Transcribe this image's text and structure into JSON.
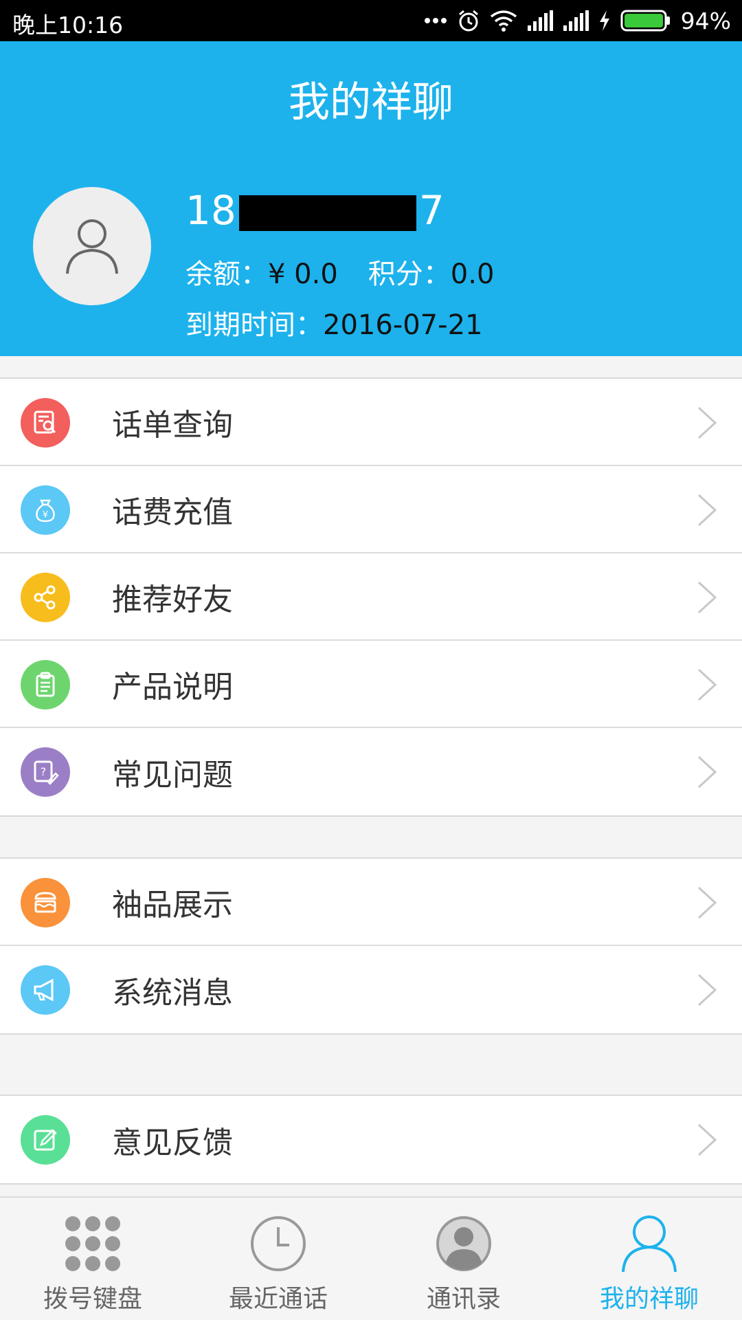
{
  "status_bar": {
    "time": "晚上10:16",
    "battery": "94%",
    "icons": [
      "more-dots-icon",
      "alarm-icon",
      "wifi-icon",
      "signal-icon",
      "signal-icon",
      "charging-icon",
      "battery-icon"
    ]
  },
  "header": {
    "title": "我的祥聊",
    "phone_prefix": "18",
    "phone_suffix": "7",
    "balance_label": "余额：",
    "balance_value": "¥ 0.0",
    "points_label": "积分：",
    "points_value": "0.0",
    "expire_label": "到期时间：",
    "expire_value": "2016-07-21"
  },
  "menu": {
    "group1": [
      {
        "label": "话单查询",
        "icon": "bill-search-icon",
        "color": "#f25f5c"
      },
      {
        "label": "话费充值",
        "icon": "money-bag-icon",
        "color": "#5bc8f5"
      },
      {
        "label": "推荐好友",
        "icon": "share-icon",
        "color": "#f7bd1c"
      },
      {
        "label": "产品说明",
        "icon": "clipboard-icon",
        "color": "#6ed56e"
      },
      {
        "label": "常见问题",
        "icon": "question-edit-icon",
        "color": "#9b7fc6"
      }
    ],
    "group2": [
      {
        "label": "袖品展示",
        "icon": "store-icon",
        "color": "#f9923a"
      },
      {
        "label": "系统消息",
        "icon": "megaphone-icon",
        "color": "#5bc8f5"
      }
    ],
    "group3": [
      {
        "label": "意见反馈",
        "icon": "feedback-edit-icon",
        "color": "#59e096"
      }
    ]
  },
  "bottom_nav": {
    "tabs": [
      {
        "label": "拨号键盘",
        "icon": "dialpad-icon"
      },
      {
        "label": "最近通话",
        "icon": "clock-icon"
      },
      {
        "label": "通讯录",
        "icon": "contact-icon"
      },
      {
        "label": "我的祥聊",
        "icon": "person-icon"
      }
    ],
    "active_index": 3,
    "active_color": "#1db2ec"
  },
  "colors": {
    "header_bg": "#1db2ec"
  }
}
